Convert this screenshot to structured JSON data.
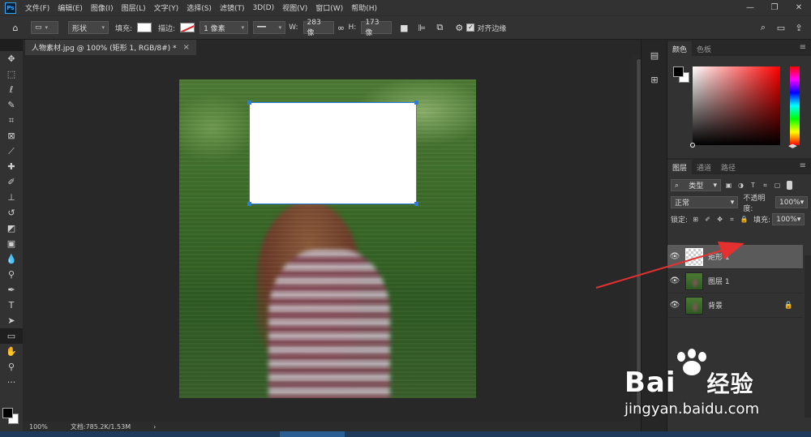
{
  "app": {
    "logo": "Ps"
  },
  "menu": [
    "文件(F)",
    "编辑(E)",
    "图像(I)",
    "图层(L)",
    "文字(Y)",
    "选择(S)",
    "滤镜(T)",
    "3D(D)",
    "视图(V)",
    "窗口(W)",
    "帮助(H)"
  ],
  "window_controls": {
    "minimize": "—",
    "restore": "❐",
    "close": "✕"
  },
  "options": {
    "shape_mode": "形状",
    "fill_label": "填充:",
    "stroke_label": "描边:",
    "stroke_width": "1 像素",
    "w_label": "W:",
    "w_value": "283 像",
    "h_label": "H:",
    "h_value": "173 像",
    "align_edges_label": "对齐边缘"
  },
  "document": {
    "tab_title": "人物素材.jpg @ 100% (矩形 1, RGB/8#) *",
    "tab_close": "×"
  },
  "status": {
    "zoom": "100%",
    "doc_info": "文档:785.2K/1.53M",
    "arrow": "›"
  },
  "color_panel": {
    "tabs": [
      "颜色",
      "色板"
    ],
    "fg_color": "#000000",
    "bg_color": "#ffffff"
  },
  "layers_panel": {
    "tabs": [
      "图层",
      "通道",
      "路径"
    ],
    "filter_type": "类型",
    "blend_mode": "正常",
    "opacity_label": "不透明度:",
    "opacity_value": "100%",
    "lock_label": "锁定:",
    "fill_label": "填充:",
    "fill_value": "100%",
    "layers": [
      {
        "name": "矩形 1",
        "selected": true,
        "thumb": "shape"
      },
      {
        "name": "图层 1",
        "selected": false,
        "thumb": "photo"
      },
      {
        "name": "背景",
        "selected": false,
        "thumb": "photo",
        "locked": true
      }
    ],
    "bottom_icons": [
      "link-icon",
      "fx-icon",
      "mask-icon",
      "adjustment-icon",
      "folder-icon",
      "new-layer-icon",
      "trash-icon"
    ]
  },
  "watermark": {
    "brand": "Bai",
    "brand_suffix": "经验",
    "url": "jingyan.baidu.com"
  },
  "colors": {
    "accent_selection": "#2a7de0",
    "annotation_arrow": "#e53030"
  }
}
